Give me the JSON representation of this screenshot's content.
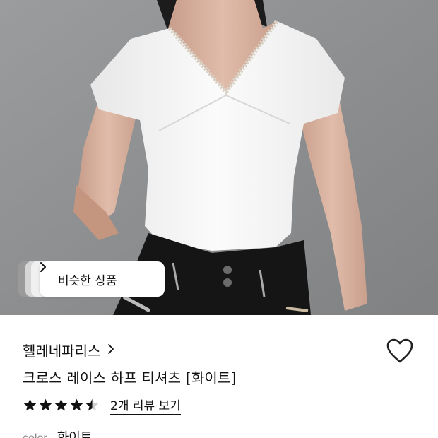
{
  "photo": {
    "alt_icon": "product-photo"
  },
  "similar": {
    "label": "비슷한 상품",
    "icon": "chevron-right-icon"
  },
  "product": {
    "brand": "헬레네파리스",
    "title": "크로스 레이스 하프 티셔츠 [화이트]",
    "rating": 4.5,
    "review_label": "2개 리뷰 보기",
    "color_label": "color",
    "color_value": "화이트"
  },
  "colors": {
    "background": "#ffffff",
    "text": "#111111",
    "muted": "#8a8a8a",
    "photo_bg": "#8d8f91"
  }
}
